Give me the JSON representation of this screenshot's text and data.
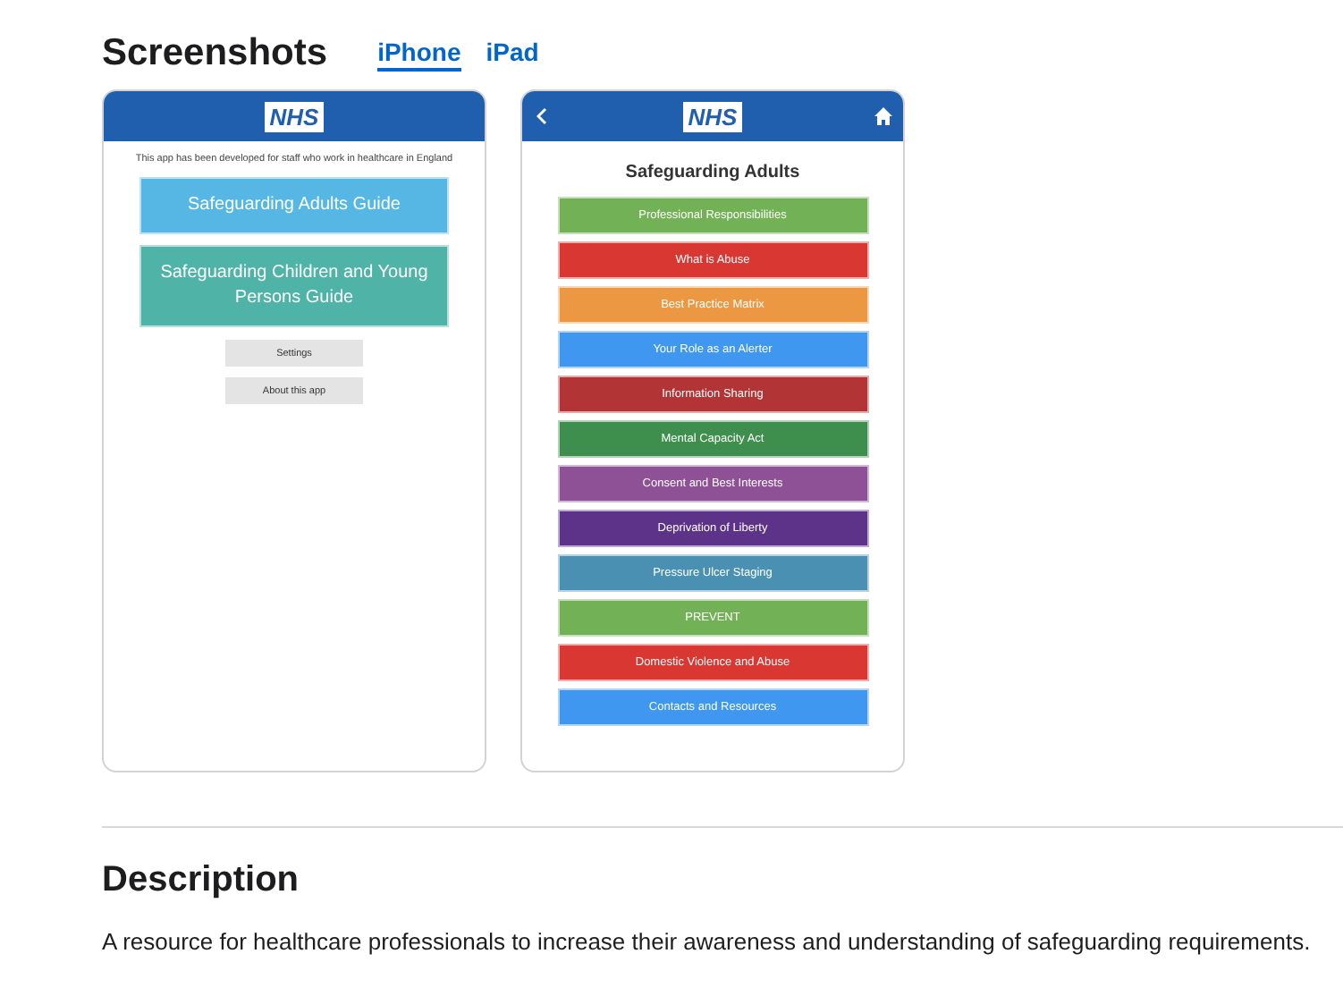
{
  "screenshots": {
    "title": "Screenshots",
    "tabs": [
      {
        "label": "iPhone",
        "selected": true
      },
      {
        "label": "iPad",
        "selected": false
      }
    ]
  },
  "phones": [
    {
      "kind": "home",
      "back": false,
      "home": false,
      "logo": "NHS",
      "intro": "This app has been developed for staff who work in healthcare in England",
      "buttons": [
        {
          "kind": "big",
          "label": "Safeguarding Adults Guide",
          "color": "#57b7e4"
        },
        {
          "kind": "big",
          "label": "Safeguarding Children and Young Persons Guide",
          "color": "#4fb3a8"
        },
        {
          "kind": "small",
          "label": "Settings"
        },
        {
          "kind": "small",
          "label": "About this app"
        }
      ]
    },
    {
      "kind": "menu",
      "back": true,
      "home": true,
      "logo": "NHS",
      "heading": "Safeguarding Adults",
      "buttons": [
        {
          "kind": "menu",
          "label": "Professional Responsibilities",
          "color": "#73b157"
        },
        {
          "kind": "menu",
          "label": "What is Abuse",
          "color": "#d83732"
        },
        {
          "kind": "menu",
          "label": "Best Practice Matrix",
          "color": "#ec9842"
        },
        {
          "kind": "menu",
          "label": "Your Role as an Alerter",
          "color": "#3f97f0"
        },
        {
          "kind": "menu",
          "label": "Information Sharing",
          "color": "#b33435"
        },
        {
          "kind": "menu",
          "label": "Mental Capacity Act",
          "color": "#3e8e4e"
        },
        {
          "kind": "menu",
          "label": "Consent and Best Interests",
          "color": "#8f5196"
        },
        {
          "kind": "menu",
          "label": "Deprivation of Liberty",
          "color": "#5d3389"
        },
        {
          "kind": "menu",
          "label": "Pressure Ulcer Staging",
          "color": "#4a90b3"
        },
        {
          "kind": "menu",
          "label": "PREVENT",
          "color": "#73b157"
        },
        {
          "kind": "menu",
          "label": "Domestic Violence and Abuse",
          "color": "#d83732"
        },
        {
          "kind": "menu",
          "label": "Contacts and Resources",
          "color": "#3f97f0"
        }
      ]
    }
  ],
  "description": {
    "title": "Description",
    "text": "A resource for healthcare professionals to increase their awareness and understanding of safeguarding requirements."
  }
}
